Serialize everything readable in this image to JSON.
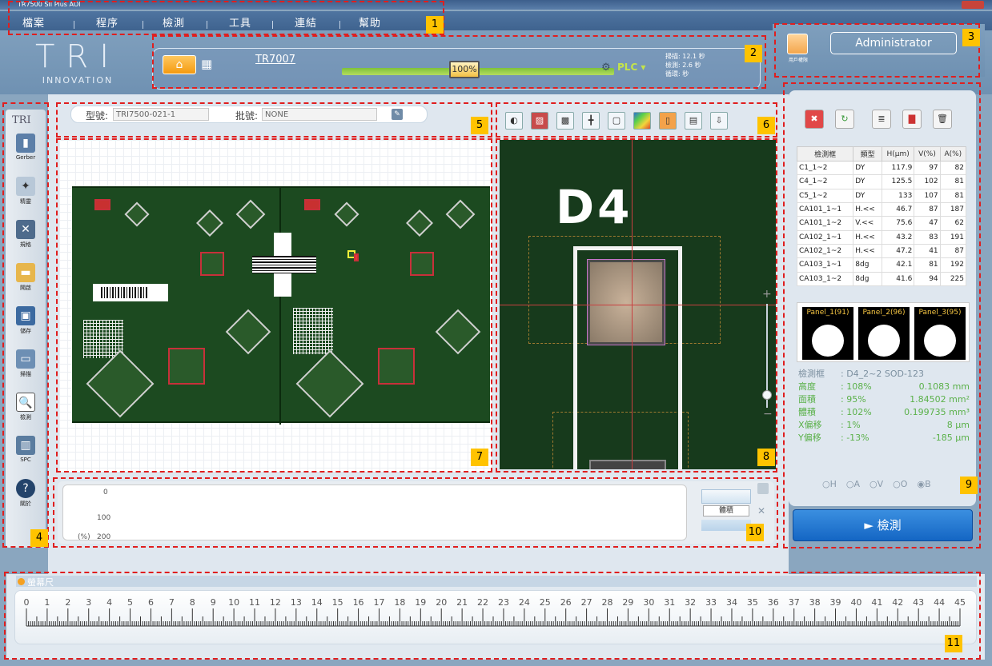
{
  "window": {
    "title": "TR7500 SII Plus AOI"
  },
  "menu": [
    "檔案",
    "程序",
    "檢測",
    "工具",
    "連結",
    "幫助"
  ],
  "logo": {
    "main": "TRI",
    "sub": "INNOVATION"
  },
  "status": {
    "model": "TR7007",
    "progress": "100%",
    "plc": "PLC",
    "times": [
      "掃描: 12.1 秒",
      "檢測: 2.6 秒",
      "循環:      秒"
    ]
  },
  "user": {
    "name": "Administrator",
    "avatar_label": "用戶權限"
  },
  "toolbar": {
    "logo": "TRI",
    "items": [
      {
        "label": "Gerber",
        "icon": "gerber-icon"
      },
      {
        "label": "精靈",
        "icon": "wizard-icon"
      },
      {
        "label": "規格",
        "icon": "tools-icon"
      },
      {
        "label": "開啟",
        "icon": "folder-icon"
      },
      {
        "label": "儲存",
        "icon": "save-icon"
      },
      {
        "label": "掃描",
        "icon": "scan-icon"
      },
      {
        "label": "檢測",
        "icon": "inspect-icon"
      },
      {
        "label": "SPC",
        "icon": "spc-icon"
      },
      {
        "label": "關於",
        "icon": "help-icon"
      }
    ]
  },
  "model_bar": {
    "model_label": "型號:",
    "model_value": "TRI7500-021-1",
    "lot_label": "批號:",
    "lot_value": "NONE"
  },
  "zoom": {
    "component": "D4"
  },
  "table": {
    "headers": [
      "檢測框",
      "類型",
      "H(μm)",
      "V(%)",
      "A(%)"
    ],
    "rows": [
      [
        "C1_1~2",
        "DY",
        "117.9",
        "97",
        "82"
      ],
      [
        "C4_1~2",
        "DY",
        "125.5",
        "102",
        "81"
      ],
      [
        "C5_1~2",
        "DY",
        "133",
        "107",
        "81"
      ],
      [
        "CA101_1~1",
        "H.<<",
        "46.7",
        "87",
        "187"
      ],
      [
        "CA101_1~2",
        "V.<<",
        "75.6",
        "47",
        "62"
      ],
      [
        "CA102_1~1",
        "H.<<",
        "43.2",
        "83",
        "191"
      ],
      [
        "CA102_1~2",
        "H.<<",
        "47.2",
        "41",
        "87"
      ],
      [
        "CA103_1~1",
        "8dg",
        "42.1",
        "81",
        "192"
      ],
      [
        "CA103_1~2",
        "8dg",
        "41.6",
        "94",
        "225"
      ]
    ]
  },
  "panels": [
    "Panel_1(91)",
    "Panel_2(96)",
    "Panel_3(95)"
  ],
  "info": {
    "box_label": "檢測框",
    "box_value": ": D4_2~2  SOD-123",
    "rows": [
      {
        "k": "高度",
        "pct": ": 108%",
        "val": "0.1083 mm"
      },
      {
        "k": "面積",
        "pct": ": 95%",
        "val": "1.84502 mm²"
      },
      {
        "k": "體積",
        "pct": ": 102%",
        "val": "0.199735 mm³"
      },
      {
        "k": "X偏移",
        "pct": ": 1%",
        "val": "8 μm"
      },
      {
        "k": "Y偏移",
        "pct": ": -13%",
        "val": "-185 μm"
      }
    ],
    "radios": [
      "H",
      "A",
      "V",
      "O",
      "B"
    ]
  },
  "detect_button": "► 檢測",
  "chart": {
    "ticks": [
      "0",
      "100",
      "200"
    ],
    "unit": "(%)",
    "mode": "體積"
  },
  "ruler": {
    "title": "螢幕尺",
    "max": 45
  },
  "annotations": [
    "1",
    "2",
    "3",
    "4",
    "5",
    "6",
    "7",
    "8",
    "9",
    "10",
    "11"
  ]
}
